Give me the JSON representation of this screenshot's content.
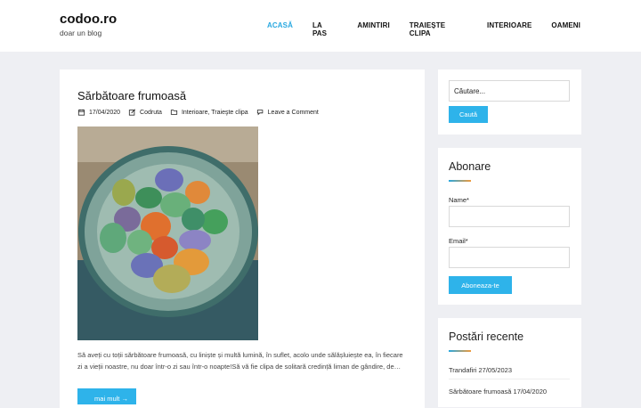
{
  "site": {
    "title": "codoo.ro",
    "tagline": "doar un blog"
  },
  "nav": [
    {
      "label": "ACASĂ",
      "active": true
    },
    {
      "label": "LA PAS"
    },
    {
      "label": "AMINTIRI"
    },
    {
      "label": "TRAIEȘTE CLIPA"
    },
    {
      "label": "INTERIOARE"
    },
    {
      "label": "OAMENI"
    }
  ],
  "post": {
    "title": "Sărbătoare frumoasă",
    "date": "17/04/2020",
    "author": "Codruta",
    "categories": "Interioare, Traieşte clipa",
    "comments": "Leave a Comment",
    "excerpt": "Să aveți cu toții sărbătoare frumoasă, cu liniște și multă lumină, în suflet, acolo unde sălășluiește ea, în fiecare zi a vieții noastre, nu doar într-o zi sau într-o noapte!Să vă fie clipa de solitară credință liman de gândire, de…",
    "more_label": "mai mult →"
  },
  "search": {
    "placeholder": "Căutare...",
    "button": "Caută"
  },
  "subscribe": {
    "title": "Abonare",
    "name_label": "Name*",
    "email_label": "Email*",
    "button": "Aboneaza-te"
  },
  "recent": {
    "title": "Postări recente",
    "items": [
      "Trandafiri 27/05/2023",
      "Sărbătoare frumoasă 17/04/2020"
    ]
  },
  "colors": {
    "accent": "#28a8e0",
    "button": "#2eb3ea",
    "bg": "#eeeff3"
  },
  "icons": [
    "calendar-icon",
    "edit-icon",
    "folder-icon",
    "comment-icon",
    "arrow-right-icon"
  ]
}
